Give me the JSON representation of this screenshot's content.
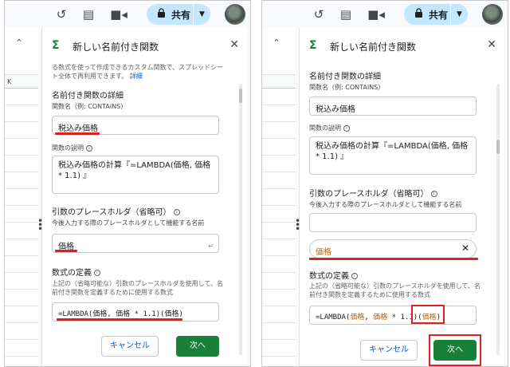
{
  "panels": [
    {
      "topbar": {
        "share_label": "共有"
      },
      "sheet": {
        "column_letter": "K"
      },
      "sidebar": {
        "title": "新しい名前付き関数",
        "intro_text": "る数式を使って作成できるカスタム関数で、スプレッドシート全体で再利用できます。",
        "intro_link": "詳細",
        "details_heading": "名前付き関数の詳細",
        "name_label": "関数名（例: CONTAINS）",
        "name_value": "税込み価格",
        "desc_label": "関数の説明",
        "desc_value": "税込み価格の計算『=LAMBDA(価格, 価格 * 1.1) 』",
        "placeholder_heading": "引数のプレースホルダ（省略可）",
        "placeholder_help": "今後入力する際のプレースホルダとして機能する名前",
        "placeholder_value": "価格",
        "placeholder_mark": "↵",
        "formula_heading": "数式の定義",
        "formula_help": "上記の（省略可能な）引数のプレースホルダを使用して、名前付き関数を定義するために使用する数式",
        "formula_value": "=LAMBDA(価格, 価格 * 1.1)(価格)",
        "cancel_label": "キャンセル",
        "next_label": "次へ"
      }
    },
    {
      "topbar": {
        "share_label": "共有"
      },
      "sheet": {
        "column_letter": ""
      },
      "sidebar": {
        "title": "新しい名前付き関数",
        "details_heading": "名前付き関数の詳細",
        "name_label": "関数名（例: CONTAINS）",
        "name_value": "税込み価格",
        "desc_label": "関数の説明",
        "desc_value": "税込み価格の計算『=LAMBDA(価格, 価格 * 1.1) 』",
        "placeholder_heading": "引数のプレースホルダ（省略可）",
        "placeholder_help": "今後入力する際のプレースホルダとして機能する名前",
        "placeholder_chip": "価格",
        "formula_heading": "数式の定義",
        "formula_help": "上記の（省略可能な）引数のプレースホルダを使用して、名前付き関数を定義するために使用する数式",
        "formula_prefix": "=LAMBDA(",
        "formula_arg1": "価格",
        "formula_mid": ", ",
        "formula_arg2": "価格",
        "formula_mid2": " * 1.1)(",
        "formula_arg3": "価格",
        "formula_suffix": ")",
        "cancel_label": "キャンセル",
        "next_label": "次へ"
      }
    }
  ],
  "colors": {
    "accent_green": "#188038",
    "share_blue": "#c2e7ff",
    "highlight_red": "#e02020",
    "link_blue": "#0b57d0"
  },
  "icons": [
    "history-icon",
    "comment-icon",
    "video-icon",
    "lock-icon",
    "chevron-down-icon",
    "avatar",
    "close-icon",
    "sigma-icon",
    "info-icon",
    "drag-handle-icon"
  ]
}
